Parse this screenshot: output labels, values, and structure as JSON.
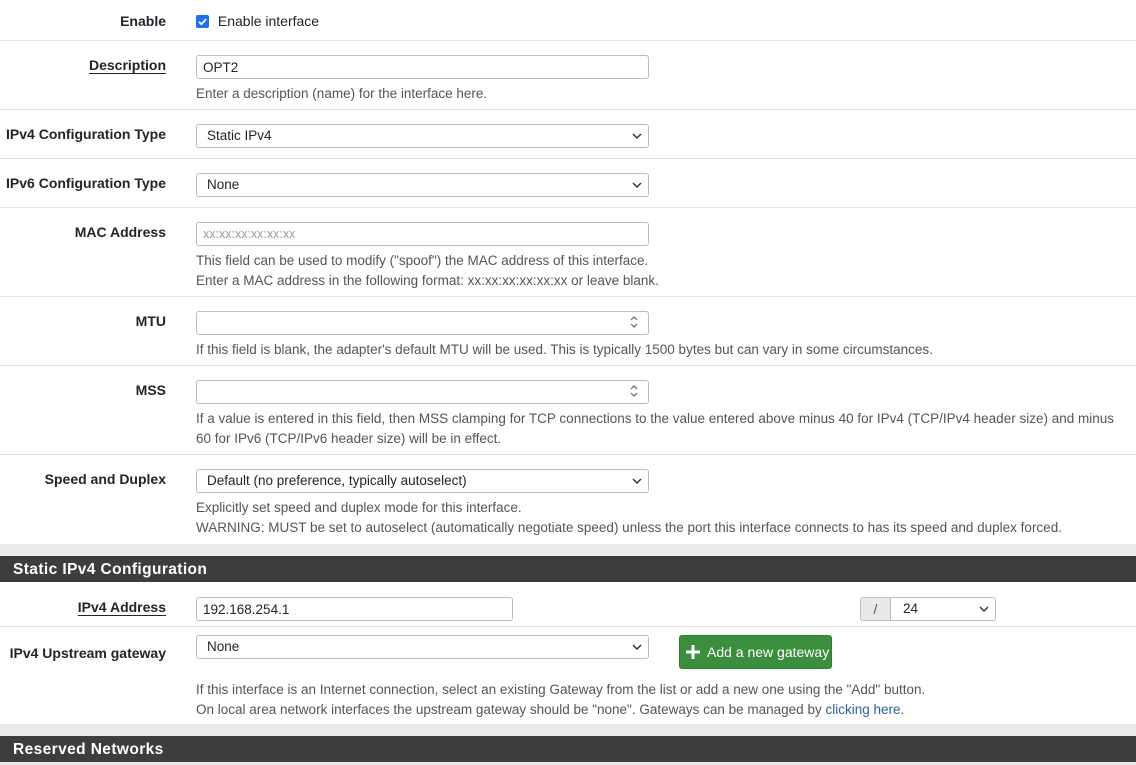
{
  "interface": {
    "enable_label": "Enable",
    "enable_checkbox_label": "Enable interface",
    "enable_checked": true,
    "description_label": "Description",
    "description_value": "OPT2",
    "description_help": "Enter a description (name) for the interface here.",
    "ipv4_type_label": "IPv4 Configuration Type",
    "ipv4_type_value": "Static IPv4",
    "ipv6_type_label": "IPv6 Configuration Type",
    "ipv6_type_value": "None",
    "mac_label": "MAC Address",
    "mac_placeholder": "xx:xx:xx:xx:xx:xx",
    "mac_help_1": "This field can be used to modify (\"spoof\") the MAC address of this interface.",
    "mac_help_2": "Enter a MAC address in the following format: xx:xx:xx:xx:xx:xx or leave blank.",
    "mtu_label": "MTU",
    "mtu_help": "If this field is blank, the adapter's default MTU will be used. This is typically 1500 bytes but can vary in some circumstances.",
    "mss_label": "MSS",
    "mss_help_1": "If a value is entered in this field, then MSS clamping for TCP connections to the value entered above minus 40 for IPv4 (TCP/IPv4 header size) and minus",
    "mss_help_2": "60 for IPv6 (TCP/IPv6 header size) will be in effect.",
    "speed_label": "Speed and Duplex",
    "speed_value": "Default (no preference, typically autoselect)",
    "speed_help_1": "Explicitly set speed and duplex mode for this interface.",
    "speed_help_2": "WARNING: MUST be set to autoselect (automatically negotiate speed) unless the port this interface connects to has its speed and duplex forced."
  },
  "static_ipv4": {
    "section_title": "Static IPv4 Configuration",
    "address_label": "IPv4 Address",
    "address_value": "192.168.254.1",
    "slash": "/",
    "prefix_value": "24",
    "gateway_label": "IPv4 Upstream gateway",
    "gateway_value": "None",
    "add_gateway_label": "Add a new gateway",
    "gateway_help_1": "If this interface is an Internet connection, select an existing Gateway from the list or add a new one using the \"Add\" button.",
    "gateway_help_2_prefix": "On local area network interfaces the upstream gateway should be \"none\". Gateways can be managed by ",
    "gateway_help_link": "clicking here",
    "gateway_help_2_suffix": "."
  },
  "reserved": {
    "section_title": "Reserved Networks"
  },
  "colors": {
    "section_header_bg": "#3d3d3d",
    "button_green": "#3b8e3b",
    "link": "#2a6496",
    "checkbox": "#1a73e8"
  },
  "icons": [
    "checkmark-icon",
    "chevron-down-icon",
    "spinner-arrows-icon",
    "plus-icon"
  ]
}
